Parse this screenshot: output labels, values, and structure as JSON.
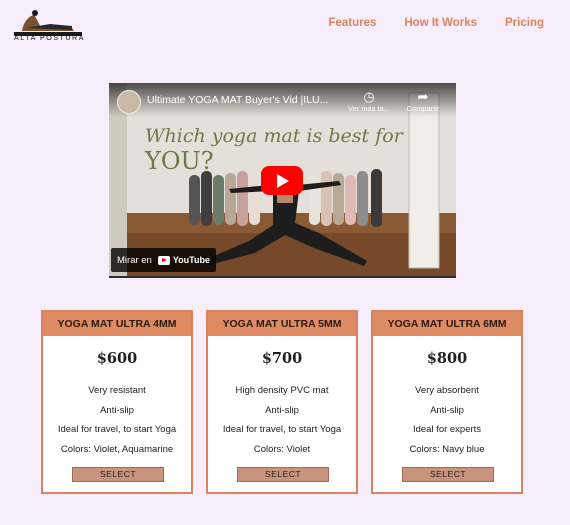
{
  "brand": {
    "name": "ALTA POSTURA"
  },
  "nav": [
    {
      "label": "Features"
    },
    {
      "label": "How It Works"
    },
    {
      "label": "Pricing"
    }
  ],
  "video": {
    "title": "Ultimate YOGA MAT Buyer's Vid |ILU...",
    "watch_later": "Ver más ta...",
    "share": "Compartir",
    "overlay_text": "Which yoga mat is best for",
    "overlay_big": "YOU?",
    "watch_on": "Mirar en",
    "youtube": "YouTube"
  },
  "plans": [
    {
      "name": "YOGA MAT ULTRA 4MM",
      "price": "$600",
      "features": [
        "Very resistant",
        "Anti-slip",
        "Ideal for travel, to start Yoga",
        "Colors: Violet, Aquamarine"
      ],
      "button": "SELECT"
    },
    {
      "name": "YOGA MAT ULTRA 5MM",
      "price": "$700",
      "features": [
        "High density PVC mat",
        "Anti-slip",
        "Ideal for travel, to start Yoga",
        "Colors: Violet"
      ],
      "button": "SELECT"
    },
    {
      "name": "YOGA MAT ULTRA 6MM",
      "price": "$800",
      "features": [
        "Very absorbent",
        "Anti-slip",
        "Ideal for experts",
        "Colors: Navy blue"
      ],
      "button": "SELECT"
    }
  ],
  "colors": {
    "accent": "#de8a63",
    "background": "#f8edfb",
    "button": "#c9937d"
  }
}
